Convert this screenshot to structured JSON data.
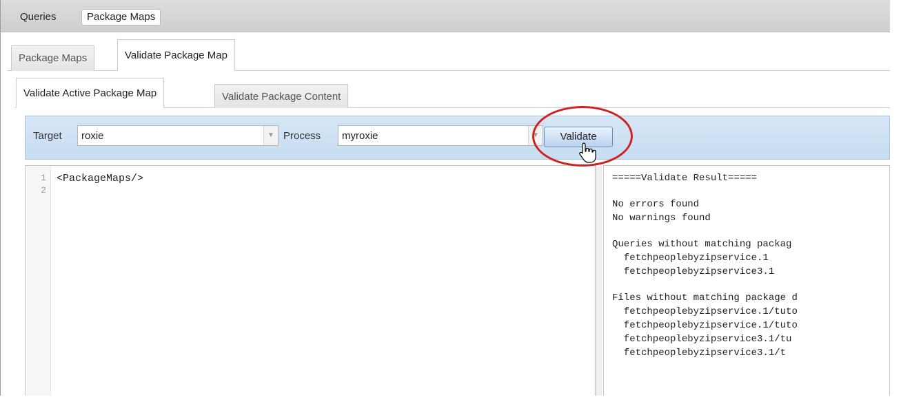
{
  "top_tabs": {
    "queries": "Queries",
    "package_maps": "Package Maps"
  },
  "second_tabs": [
    "Package Maps",
    "Validate Package Map"
  ],
  "third_tabs": [
    "Validate Active Package Map",
    "Validate Package Content"
  ],
  "toolbar": {
    "target_label": "Target",
    "target_value": "roxie",
    "process_label": "Process",
    "process_value": "myroxie",
    "validate_button": "Validate"
  },
  "editor": {
    "line_numbers": [
      "1",
      "2"
    ],
    "code": "<PackageMaps/>"
  },
  "result": {
    "lines": [
      "=====Validate Result=====",
      "No errors found",
      "No warnings found",
      "Queries without matching packag",
      "  fetchpeoplebyzipservice.1",
      "  fetchpeoplebyzipservice3.1",
      "Files without matching package d",
      "  fetchpeoplebyzipservice.1/tuto",
      "  fetchpeoplebyzipservice.1/tuto",
      "  fetchpeoplebyzipservice3.1/tu",
      "  fetchpeoplebyzipservice3.1/t"
    ]
  },
  "colors": {
    "highlight": "#d12020",
    "toolbar_bg": "#c8ddf2"
  }
}
